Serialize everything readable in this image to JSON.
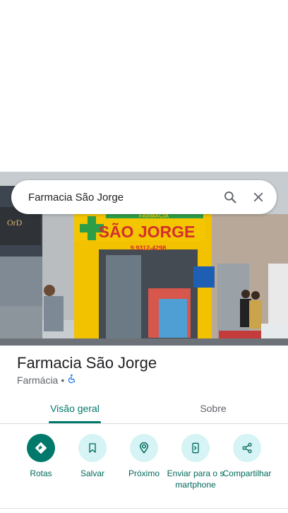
{
  "search": {
    "query": "Farmacia São Jorge"
  },
  "place": {
    "name": "Farmacia São Jorge",
    "category": "Farmácia",
    "separator": "•"
  },
  "photo_signage": {
    "top_text": "FARMÁCIA",
    "main_text": "SÃO JORGE",
    "phone": "9 9312-4298",
    "neighbor_sign": "OrD"
  },
  "tabs": [
    {
      "label": "Visão geral",
      "active": true
    },
    {
      "label": "Sobre",
      "active": false
    }
  ],
  "actions": [
    {
      "label": "Rotas",
      "icon": "directions-icon"
    },
    {
      "label": "Salvar",
      "icon": "bookmark-icon"
    },
    {
      "label": "Próximo",
      "icon": "nearby-icon"
    },
    {
      "label": "Enviar para o smartphone",
      "icon": "send-to-phone-icon"
    },
    {
      "label": "Compartilhar",
      "icon": "share-icon"
    }
  ],
  "colors": {
    "accent": "#00796b",
    "action_bg": "#d6f3f5",
    "sign_yellow": "#f2c200",
    "sign_red": "#d32f2f"
  }
}
